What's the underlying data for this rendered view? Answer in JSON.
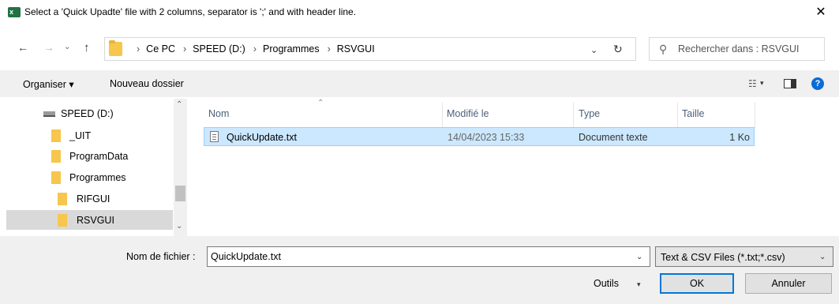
{
  "window": {
    "title": "Select a 'Quick Upadte' file with 2 columns, separator is ';' and with header line.",
    "app_icon_text": "x",
    "close_glyph": "✕"
  },
  "navigation": {
    "back_glyph": "←",
    "forward_glyph": "→",
    "recent_glyph": "⌄",
    "up_glyph": "↑",
    "breadcrumb": [
      "Ce PC",
      "SPEED (D:)",
      "Programmes",
      "RSVGUI"
    ],
    "breadcrumb_separator": "›",
    "address_dropdown_glyph": "⌄",
    "refresh_glyph": "↻"
  },
  "search": {
    "placeholder": "Rechercher dans : RSVGUI",
    "icon": "search-icon"
  },
  "toolbar": {
    "organise_label": "Organiser ▾",
    "new_folder_label": "Nouveau dossier",
    "views_glyph": "☷",
    "views_chevron": "▾",
    "help_glyph": "?"
  },
  "nav_pane": {
    "items": [
      {
        "label": "SPEED (D:)",
        "icon": "drive-icon",
        "selected": false
      },
      {
        "label": "_UIT",
        "icon": "folder-icon",
        "selected": false
      },
      {
        "label": "ProgramData",
        "icon": "folder-icon",
        "selected": false
      },
      {
        "label": "Programmes",
        "icon": "folder-icon",
        "selected": false
      },
      {
        "label": "RIFGUI",
        "icon": "folder-icon",
        "selected": false
      },
      {
        "label": "RSVGUI",
        "icon": "folder-icon",
        "selected": true
      }
    ],
    "scroll_up_glyph": "⌃",
    "scroll_down_glyph": "⌄"
  },
  "file_list": {
    "sort_glyph": "⌃",
    "columns": [
      "Nom",
      "Modifié le",
      "Type",
      "Taille"
    ],
    "rows": [
      {
        "name": "QuickUpdate.txt",
        "modified": "14/04/2023 15:33",
        "type": "Document texte",
        "size": "1 Ko",
        "selected": true
      }
    ]
  },
  "footer": {
    "filename_label": "Nom de fichier :",
    "filename_value": "QuickUpdate.txt",
    "filename_dropdown_glyph": "⌄",
    "filetype_value": "Text & CSV Files (*.txt;*.csv)",
    "filetype_dropdown_glyph": "⌄",
    "tools_label": "Outils",
    "tools_chevron": "▾",
    "ok_label": "OK",
    "cancel_label": "Annuler"
  },
  "colors": {
    "selection_bg": "#cce8ff",
    "selection_border": "#99d1ff",
    "default_button_border": "#0078d7",
    "folder": "#f6c64d",
    "excel_green": "#1f7244",
    "help_blue": "#0a6cd6"
  }
}
